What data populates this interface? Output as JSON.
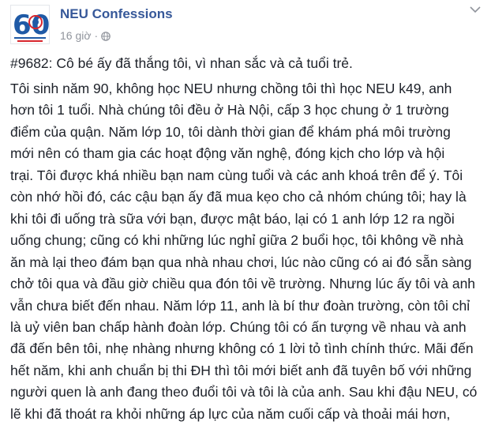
{
  "post": {
    "page_name": "NEU Confessions",
    "timestamp": "16 giờ",
    "separator": "·",
    "title": "#9682: Cô bé ấy đã thắng tôi, vì nhan sắc và cả tuổi trẻ.",
    "body_lines": [
      "Tôi sinh năm 90, không học NEU nhưng chồng tôi thì học NEU k49, anh",
      "hơn tôi 1 tuổi. Nhà chúng tôi đều ở Hà Nội, cấp 3 học chung ở 1 trường",
      "điểm của quận. Năm lớp 10, tôi dành thời gian để khám phá môi trường",
      "mới nên có tham gia các hoạt động văn nghệ, đóng kịch cho lớp và hội",
      "trại. Tôi được khá nhiều bạn nam cùng tuổi và các anh khoá trên để ý. Tôi",
      "còn nhớ hồi đó, các cậu bạn ấy đã mua kẹo cho cả nhóm chúng tôi; hay là",
      "khi tôi đi uống trà sữa với bạn, được mật báo, lại có 1 anh lớp 12 ra ngồi",
      "uống chung; cũng có khi những lúc nghỉ giữa 2 buổi học, tôi không về nhà",
      "ăn mà lại theo đám bạn qua nhà nhau chơi, lúc nào cũng có ai đó sẵn sàng",
      "chở tôi qua và đầu giờ chiều qua đón tôi về trường. Nhưng lúc ấy tôi và anh",
      "vẫn chưa biết đến nhau. Năm lớp 11, anh là bí thư đoàn trường, còn tôi chỉ",
      "là uỷ viên ban chấp hành đoàn lớp. Chúng tôi có ấn tượng về nhau và anh",
      "đã đến bên tôi, nhẹ nhàng nhưng không có 1 lời tỏ tình chính thức. Mãi đến",
      "hết năm, khi anh chuẩn bị thi ĐH thì tôi mới biết anh đã tuyên bố với những",
      "người quen là anh đang theo đuổi tôi và tôi là của anh. Sau khi đậu NEU, có",
      "lẽ khi đã thoát ra khỏi những áp lực của năm cuối cấp và thoải mái hơn,"
    ]
  },
  "avatar": {
    "logo_number": "60"
  },
  "icons": {
    "privacy": "globe-icon",
    "menu": "chevron-down-icon"
  },
  "colors": {
    "page_name": "#365899",
    "meta_text": "#90949c",
    "body_text": "#1d2129",
    "logo_blue": "#1f5aa6",
    "logo_red": "#d8262d"
  }
}
